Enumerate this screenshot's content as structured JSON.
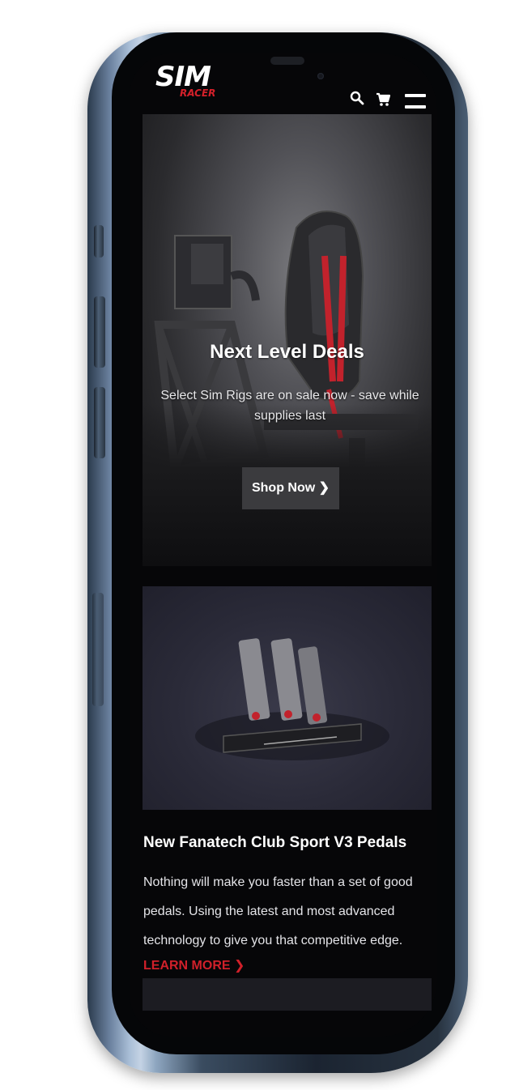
{
  "header": {
    "logo_main": "SIM",
    "logo_sub": "RACER",
    "search_icon": "search-icon",
    "cart_icon": "cart-icon",
    "menu_icon": "hamburger-menu-icon"
  },
  "hero": {
    "title": "Next Level Deals",
    "subtitle": "Select Sim Rigs are on sale now - save while supplies last",
    "button_label": "Shop Now ❯"
  },
  "product": {
    "title": "New Fanatech Club Sport V3 Pedals",
    "description": "Nothing will make you faster than a set of good pedals. Using the latest and most advanced technology to give you that competitive edge.",
    "link_label": "LEARN MORE ❯"
  },
  "colors": {
    "accent": "#d0202a",
    "background": "#060608",
    "button": "#3b3b3e"
  }
}
